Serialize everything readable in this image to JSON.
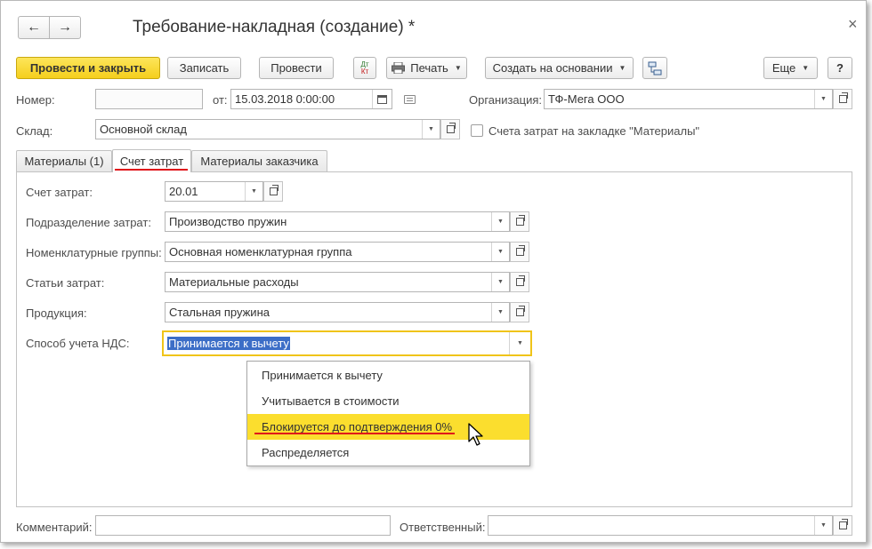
{
  "window": {
    "title": "Требование-накладная (создание) *",
    "close_glyph": "×",
    "nav_back_glyph": "←",
    "nav_forward_glyph": "→"
  },
  "toolbar": {
    "post_close_label": "Провести и закрыть",
    "save_label": "Записать",
    "post_label": "Провести",
    "dt_label": "Дт",
    "kt_label": "Кт",
    "print_label": "Печать",
    "create_based_label": "Создать на основании",
    "more_label": "Еще",
    "help_label": "?"
  },
  "header": {
    "number_label": "Номер:",
    "number_value": "",
    "date_label": "от:",
    "date_value": "15.03.2018  0:00:00",
    "org_label": "Организация:",
    "org_value": "ТФ-Мега ООО",
    "warehouse_label": "Склад:",
    "warehouse_value": "Основной склад",
    "cost_accounts_checkbox_label": "Счета затрат на закладке \"Материалы\"",
    "cost_accounts_checked": false
  },
  "tabs": [
    {
      "label": "Материалы (1)",
      "active": false
    },
    {
      "label": "Счет затрат",
      "active": true
    },
    {
      "label": "Материалы заказчика",
      "active": false
    }
  ],
  "cost_tab": {
    "account_label": "Счет затрат:",
    "account_value": "20.01",
    "division_label": "Подразделение затрат:",
    "division_value": "Производство пружин",
    "nomenclature_label": "Номенклатурные группы:",
    "nomenclature_value": "Основная номенклатурная группа",
    "cost_items_label": "Статьи затрат:",
    "cost_items_value": "Материальные расходы",
    "product_label": "Продукция:",
    "product_value": "Стальная пружина",
    "vat_label": "Способ учета НДС:",
    "vat_value": "Принимается к вычету"
  },
  "vat_dropdown": {
    "options": [
      {
        "label": "Принимается к вычету",
        "highlighted": false
      },
      {
        "label": "Учитывается в стоимости",
        "highlighted": false
      },
      {
        "label": "Блокируется до подтверждения 0%",
        "highlighted": true
      },
      {
        "label": "Распределяется",
        "highlighted": false
      }
    ]
  },
  "footer": {
    "comment_label": "Комментарий:",
    "comment_value": "",
    "responsible_label": "Ответственный:",
    "responsible_value": ""
  },
  "colors": {
    "accent_yellow": "#f5cf1d",
    "highlight_yellow": "#fbde2e",
    "underline_red": "#e0121a",
    "selection_blue": "#3c6ec7"
  }
}
